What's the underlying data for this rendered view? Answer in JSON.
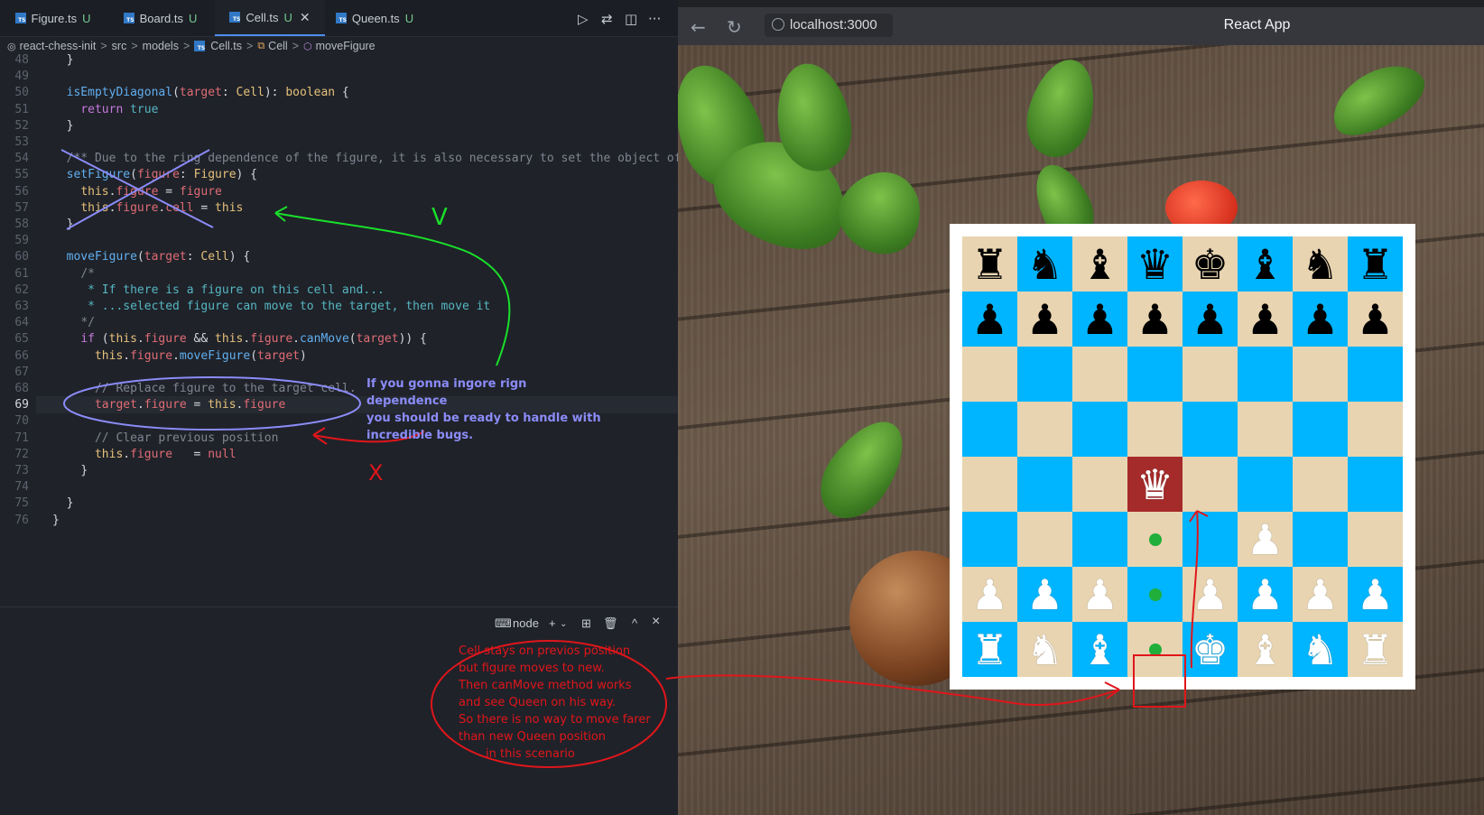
{
  "editor": {
    "tabs": [
      {
        "label": "Figure.ts",
        "badge": "U",
        "active": false
      },
      {
        "label": "Board.ts",
        "badge": "U",
        "active": false
      },
      {
        "label": "Cell.ts",
        "badge": "U",
        "active": true
      },
      {
        "label": "Queen.ts",
        "badge": "U",
        "active": false
      }
    ],
    "breadcrumb": [
      "react-chess-init",
      "src",
      "models",
      "Cell.ts",
      "Cell",
      "moveFigure"
    ],
    "current_line": "69",
    "code": [
      {
        "n": "48",
        "html": "  <span class='w'>}</span>"
      },
      {
        "n": "49",
        "html": ""
      },
      {
        "n": "50",
        "html": "  <span class='f'>isEmptyDiagonal</span><span class='w'>(</span><span class='v'>target</span><span class='w'>: </span><span class='t'>Cell</span><span class='w'>): </span><span class='t'>boolean</span><span class='w'> {</span>"
      },
      {
        "n": "51",
        "html": "    <span class='k'>return</span> <span class='o'>true</span>"
      },
      {
        "n": "52",
        "html": "  <span class='w'>}</span>"
      },
      {
        "n": "53",
        "html": ""
      },
      {
        "n": "54",
        "html": "  <span class='c'>/** Due to the ring dependence of the figure, it is also necessary to set the object of</span>"
      },
      {
        "n": "55",
        "html": "  <span class='f'>setFigure</span><span class='w'>(</span><span class='v'>figure</span><span class='w'>: </span><span class='t'>Figure</span><span class='w'>) {</span>"
      },
      {
        "n": "56",
        "html": "    <span class='p'>this</span><span class='w'>.</span><span class='v'>figure</span><span class='w'> = </span><span class='v'>figure</span>"
      },
      {
        "n": "57",
        "html": "    <span class='p'>this</span><span class='w'>.</span><span class='v'>figure</span><span class='w'>.</span><span class='v'>cell</span><span class='w'> = </span><span class='p'>this</span>"
      },
      {
        "n": "58",
        "html": "  <span class='w'>}</span>"
      },
      {
        "n": "59",
        "html": ""
      },
      {
        "n": "60",
        "html": "  <span class='f'>moveFigure</span><span class='w'>(</span><span class='v'>target</span><span class='w'>: </span><span class='t'>Cell</span><span class='w'>) {</span>"
      },
      {
        "n": "61",
        "html": "    <span class='c'>/*</span>"
      },
      {
        "n": "62",
        "html": "     <span class='o'>* If there is a figure on this cell and...</span>"
      },
      {
        "n": "63",
        "html": "     <span class='o'>* ...selected figure can move to the target, then move it</span>"
      },
      {
        "n": "64",
        "html": "    <span class='c'>*/</span>"
      },
      {
        "n": "65",
        "html": "    <span class='k'>if</span><span class='w'> (</span><span class='p'>this</span><span class='w'>.</span><span class='v'>figure</span><span class='w'> &amp;&amp; </span><span class='p'>this</span><span class='w'>.</span><span class='v'>figure</span><span class='w'>.</span><span class='f'>canMove</span><span class='w'>(</span><span class='v'>target</span><span class='w'>)) {</span>"
      },
      {
        "n": "66",
        "html": "      <span class='p'>this</span><span class='w'>.</span><span class='v'>figure</span><span class='w'>.</span><span class='f'>moveFigure</span><span class='w'>(</span><span class='v'>target</span><span class='w'>)</span>"
      },
      {
        "n": "67",
        "html": ""
      },
      {
        "n": "68",
        "html": "      <span class='c'>// Replace figure to the target cell.</span>"
      },
      {
        "n": "69",
        "html": "      <span class='v'>target</span><span class='w'>.</span><span class='v'>figure</span><span class='w'> = </span><span class='p'>this</span><span class='w'>.</span><span class='v'>figure</span>"
      },
      {
        "n": "70",
        "html": ""
      },
      {
        "n": "71",
        "html": "      <span class='c'>// Clear previous position</span>"
      },
      {
        "n": "72",
        "html": "      <span class='p'>this</span><span class='w'>.</span><span class='v'>figure</span><span class='w'>   = </span><span class='v'>null</span>"
      },
      {
        "n": "73",
        "html": "    <span class='w'>}</span>"
      },
      {
        "n": "74",
        "html": ""
      },
      {
        "n": "75",
        "html": "  <span class='w'>}</span>"
      },
      {
        "n": "76",
        "html": "<span class='w'>}</span>"
      }
    ],
    "terminal": {
      "label": "node",
      "add": "+",
      "split": "⊞",
      "trash": "🗑",
      "up": "^",
      "close": "×"
    }
  },
  "browser": {
    "url": "localhost:3000",
    "title": "React App"
  },
  "board": {
    "light_color": "#e8d4b0",
    "dark_color": "#00b5ff",
    "selected_color": "#a52a2a",
    "move_dot_color": "#1faf3a",
    "rows": [
      [
        "bR",
        "bN",
        "bB",
        "bQ",
        "bK",
        "bB",
        "bN",
        "bR"
      ],
      [
        "bP",
        "bP",
        "bP",
        "bP",
        "bP",
        "bP",
        "bP",
        "bP"
      ],
      [
        "",
        "",
        "",
        "",
        "",
        "",
        "",
        ""
      ],
      [
        "",
        "",
        "",
        "",
        "",
        "",
        "",
        ""
      ],
      [
        "",
        "",
        "",
        "wQ*",
        "",
        "",
        "",
        ""
      ],
      [
        "",
        "",
        "",
        "dot",
        "",
        "wP",
        "",
        ""
      ],
      [
        "wP",
        "wP",
        "wP",
        "dot",
        "wP",
        "wP",
        "wP",
        "wP"
      ],
      [
        "wR",
        "wN",
        "wB",
        "dot",
        "wK",
        "wB",
        "wN",
        "wR"
      ]
    ]
  },
  "annotations": {
    "purple_note": [
      "If you gonna ingore rign dependence",
      "you should be ready to handle with",
      "incredible bugs."
    ],
    "green_mark": "V",
    "red_mark": "X",
    "red_note": [
      "Cell stays on previos position",
      "but figure moves to new.",
      "Then canMove method works",
      "and see Queen on his way.",
      "So there is no way to move farer",
      "than new Queen position",
      "in this scenario"
    ]
  }
}
